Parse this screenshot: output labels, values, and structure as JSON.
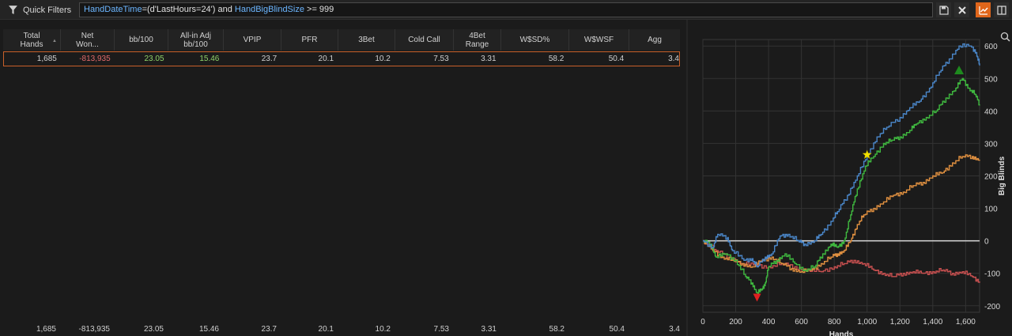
{
  "toolbar": {
    "quick_filters_label": "Quick Filters",
    "filter_parts": [
      "HandDateTime",
      "=(d'LastHours=24') and ",
      "HandBigBlindSize",
      " >= 999"
    ],
    "buttons": [
      "save-icon",
      "close-icon",
      "line-chart-icon",
      "split-view-icon"
    ],
    "accent_color": "#e0661b"
  },
  "table": {
    "columns": [
      {
        "label": "Total\nHands"
      },
      {
        "label": "Net\nWon..."
      },
      {
        "label": "bb/100"
      },
      {
        "label": "All-in Adj\nbb/100"
      },
      {
        "label": "VPIP"
      },
      {
        "label": "PFR"
      },
      {
        "label": "3Bet"
      },
      {
        "label": "Cold Call"
      },
      {
        "label": "4Bet\nRange"
      },
      {
        "label": "W$SD%"
      },
      {
        "label": "W$WSF"
      },
      {
        "label": "Agg"
      }
    ],
    "row": [
      "1,685",
      "-813,935",
      "23.05",
      "15.46",
      "23.7",
      "20.1",
      "10.2",
      "7.53",
      "3.31",
      "58.2",
      "50.4",
      "3.4"
    ],
    "totals": [
      "1,685",
      "-813,935",
      "23.05",
      "15.46",
      "23.7",
      "20.1",
      "10.2",
      "7.53",
      "3.31",
      "58.2",
      "50.4",
      "3.4"
    ]
  },
  "chart_data": {
    "type": "line",
    "xlabel": "Hands",
    "ylabel": "Big Blinds",
    "xlim": [
      0,
      1685
    ],
    "ylim": [
      -220,
      620
    ],
    "x_ticks": [
      "0",
      "200",
      "400",
      "600",
      "800",
      "1,000",
      "1,200",
      "1,400",
      "1,600"
    ],
    "y_ticks": [
      "600",
      "500",
      "400",
      "300",
      "200",
      "100",
      "0",
      "-100",
      "-200"
    ],
    "grid": true,
    "series": [
      {
        "color": "#4a86c8",
        "points": [
          [
            0,
            0
          ],
          [
            60,
            -20
          ],
          [
            90,
            20
          ],
          [
            150,
            10
          ],
          [
            180,
            -30
          ],
          [
            250,
            -60
          ],
          [
            300,
            -55
          ],
          [
            330,
            -80
          ],
          [
            380,
            -50
          ],
          [
            420,
            -40
          ],
          [
            470,
            15
          ],
          [
            520,
            20
          ],
          [
            580,
            0
          ],
          [
            620,
            -10
          ],
          [
            680,
            0
          ],
          [
            720,
            20
          ],
          [
            780,
            60
          ],
          [
            820,
            90
          ],
          [
            880,
            140
          ],
          [
            940,
            200
          ],
          [
            1000,
            260
          ],
          [
            1060,
            320
          ],
          [
            1120,
            350
          ],
          [
            1200,
            380
          ],
          [
            1260,
            410
          ],
          [
            1320,
            430
          ],
          [
            1380,
            470
          ],
          [
            1440,
            520
          ],
          [
            1500,
            560
          ],
          [
            1560,
            600
          ],
          [
            1630,
            600
          ],
          [
            1665,
            580
          ],
          [
            1685,
            540
          ]
        ]
      },
      {
        "color": "#3fb83f",
        "points": [
          [
            0,
            0
          ],
          [
            50,
            -10
          ],
          [
            80,
            -50
          ],
          [
            140,
            -40
          ],
          [
            200,
            -60
          ],
          [
            260,
            -110
          ],
          [
            300,
            -130
          ],
          [
            330,
            -160
          ],
          [
            360,
            -150
          ],
          [
            380,
            -130
          ],
          [
            400,
            -80
          ],
          [
            450,
            -60
          ],
          [
            500,
            -40
          ],
          [
            560,
            -70
          ],
          [
            620,
            -90
          ],
          [
            680,
            -80
          ],
          [
            730,
            -40
          ],
          [
            780,
            -10
          ],
          [
            820,
            -20
          ],
          [
            860,
            0
          ],
          [
            900,
            80
          ],
          [
            940,
            160
          ],
          [
            990,
            230
          ],
          [
            1040,
            260
          ],
          [
            1100,
            300
          ],
          [
            1150,
            310
          ],
          [
            1200,
            320
          ],
          [
            1260,
            340
          ],
          [
            1300,
            360
          ],
          [
            1360,
            380
          ],
          [
            1420,
            400
          ],
          [
            1480,
            440
          ],
          [
            1540,
            470
          ],
          [
            1580,
            500
          ],
          [
            1620,
            470
          ],
          [
            1660,
            450
          ],
          [
            1685,
            420
          ]
        ]
      },
      {
        "color": "#e09040",
        "points": [
          [
            0,
            0
          ],
          [
            60,
            -30
          ],
          [
            120,
            -50
          ],
          [
            180,
            -60
          ],
          [
            240,
            -70
          ],
          [
            300,
            -80
          ],
          [
            360,
            -60
          ],
          [
            420,
            -50
          ],
          [
            480,
            -70
          ],
          [
            540,
            -85
          ],
          [
            600,
            -95
          ],
          [
            660,
            -90
          ],
          [
            720,
            -70
          ],
          [
            780,
            -50
          ],
          [
            820,
            -40
          ],
          [
            860,
            -30
          ],
          [
            900,
            0
          ],
          [
            940,
            50
          ],
          [
            980,
            80
          ],
          [
            1040,
            100
          ],
          [
            1100,
            120
          ],
          [
            1160,
            140
          ],
          [
            1220,
            150
          ],
          [
            1280,
            170
          ],
          [
            1340,
            180
          ],
          [
            1400,
            200
          ],
          [
            1460,
            210
          ],
          [
            1520,
            240
          ],
          [
            1580,
            260
          ],
          [
            1640,
            260
          ],
          [
            1685,
            250
          ]
        ]
      },
      {
        "color": "#c85050",
        "points": [
          [
            0,
            0
          ],
          [
            80,
            -30
          ],
          [
            160,
            -50
          ],
          [
            240,
            -70
          ],
          [
            320,
            -75
          ],
          [
            400,
            -80
          ],
          [
            480,
            -70
          ],
          [
            560,
            -80
          ],
          [
            640,
            -90
          ],
          [
            720,
            -95
          ],
          [
            800,
            -80
          ],
          [
            860,
            -70
          ],
          [
            920,
            -60
          ],
          [
            980,
            -70
          ],
          [
            1040,
            -90
          ],
          [
            1100,
            -100
          ],
          [
            1160,
            -110
          ],
          [
            1220,
            -100
          ],
          [
            1280,
            -95
          ],
          [
            1340,
            -100
          ],
          [
            1400,
            -95
          ],
          [
            1460,
            -90
          ],
          [
            1520,
            -100
          ],
          [
            1580,
            -95
          ],
          [
            1640,
            -110
          ],
          [
            1685,
            -125
          ]
        ]
      }
    ],
    "markers": [
      {
        "type": "star",
        "color": "#f2e100",
        "x": 1000,
        "y": 265
      },
      {
        "type": "triangle-up",
        "color": "#1e8a1e",
        "x": 1560,
        "y": 525
      },
      {
        "type": "triangle-down",
        "color": "#e02020",
        "x": 330,
        "y": -175
      }
    ]
  }
}
